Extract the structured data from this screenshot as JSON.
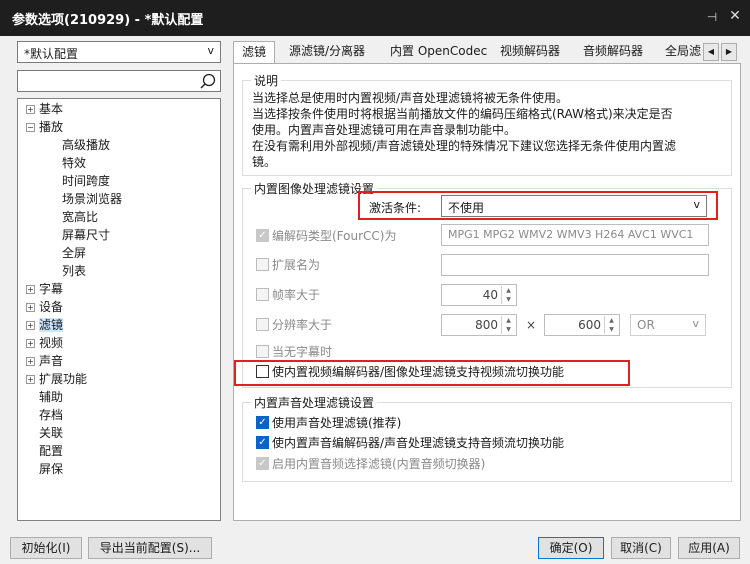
{
  "window": {
    "title": "参数选项(210929) - *默认配置",
    "pin_glyph": "⊣",
    "close_glyph": "✕"
  },
  "sidebar": {
    "profile_selected": "*默认配置",
    "search_placeholder": "",
    "tree": [
      {
        "label": "基本",
        "level": 0,
        "expander": "+"
      },
      {
        "label": "播放",
        "level": 0,
        "expander": "−"
      },
      {
        "label": "高级播放",
        "level": 1
      },
      {
        "label": "特效",
        "level": 1
      },
      {
        "label": "时间跨度",
        "level": 1
      },
      {
        "label": "场景浏览器",
        "level": 1
      },
      {
        "label": "宽高比",
        "level": 1
      },
      {
        "label": "屏幕尺寸",
        "level": 1
      },
      {
        "label": "全屏",
        "level": 1
      },
      {
        "label": "列表",
        "level": 1
      },
      {
        "label": "字幕",
        "level": 0,
        "expander": "+"
      },
      {
        "label": "设备",
        "level": 0,
        "expander": "+"
      },
      {
        "label": "滤镜",
        "level": 0,
        "expander": "+",
        "selected": true
      },
      {
        "label": "视频",
        "level": 0,
        "expander": "+"
      },
      {
        "label": "声音",
        "level": 0,
        "expander": "+"
      },
      {
        "label": "扩展功能",
        "level": 0,
        "expander": "+"
      },
      {
        "label": "辅助",
        "level": 0
      },
      {
        "label": "存档",
        "level": 0
      },
      {
        "label": "关联",
        "level": 0
      },
      {
        "label": "配置",
        "level": 0
      },
      {
        "label": "屏保",
        "level": 0
      }
    ]
  },
  "tabs": [
    {
      "label": "滤镜",
      "active": true
    },
    {
      "label": "源滤镜/分离器"
    },
    {
      "label": "内置 OpenCodec"
    },
    {
      "label": "视频解码器"
    },
    {
      "label": "音频解码器"
    },
    {
      "label": "全局滤"
    }
  ],
  "tab_scroll": {
    "left": "◀",
    "right": "▶"
  },
  "description": {
    "title": "说明",
    "lines": [
      "当选择总是使用时内置视频/声音处理滤镜将被无条件使用。",
      "当选择按条件使用时将根据当前播放文件的编码压缩格式(RAW格式)来决定是否",
      "使用。内置声音处理滤镜可用在声音录制功能中。",
      "在没有需利用外部视频/声音滤镜处理的特殊情况下建议您选择无条件使用内置滤",
      "镜。"
    ]
  },
  "video_group": {
    "title": "内置图像处理滤镜设置",
    "activation_label": "激活条件:",
    "activation_value": "不使用",
    "fourcc_label": "编解码类型(FourCC)为",
    "fourcc_value": "MPG1 MPG2 WMV2 WMV3 H264 AVC1 WVC1",
    "ext_label": "扩展名为",
    "ext_value": "",
    "fps_label": "帧率大于",
    "fps_value": "40",
    "res_label": "分辨率大于",
    "res_w": "800",
    "times": "×",
    "res_h": "600",
    "res_op": "OR",
    "nosub_label": "当无字幕时",
    "switch_label": "使内置视频编解码器/图像处理滤镜支持视频流切换功能"
  },
  "audio_group": {
    "title": "内置声音处理滤镜设置",
    "use_audio_label": "使用声音处理滤镜(推荐)",
    "audio_switch_label": "使内置声音编解码器/声音处理滤镜支持音频流切换功能",
    "audio_selector_label": "启用内置音频选择滤镜(内置音频切换器)"
  },
  "buttons": {
    "init": "初始化(I)",
    "export": "导出当前配置(S)...",
    "ok": "确定(O)",
    "cancel": "取消(C)",
    "apply": "应用(A)"
  },
  "colors": {
    "highlight": "#e32020",
    "checked": "#0a64c8",
    "titlebar": "#1e1e1e"
  }
}
